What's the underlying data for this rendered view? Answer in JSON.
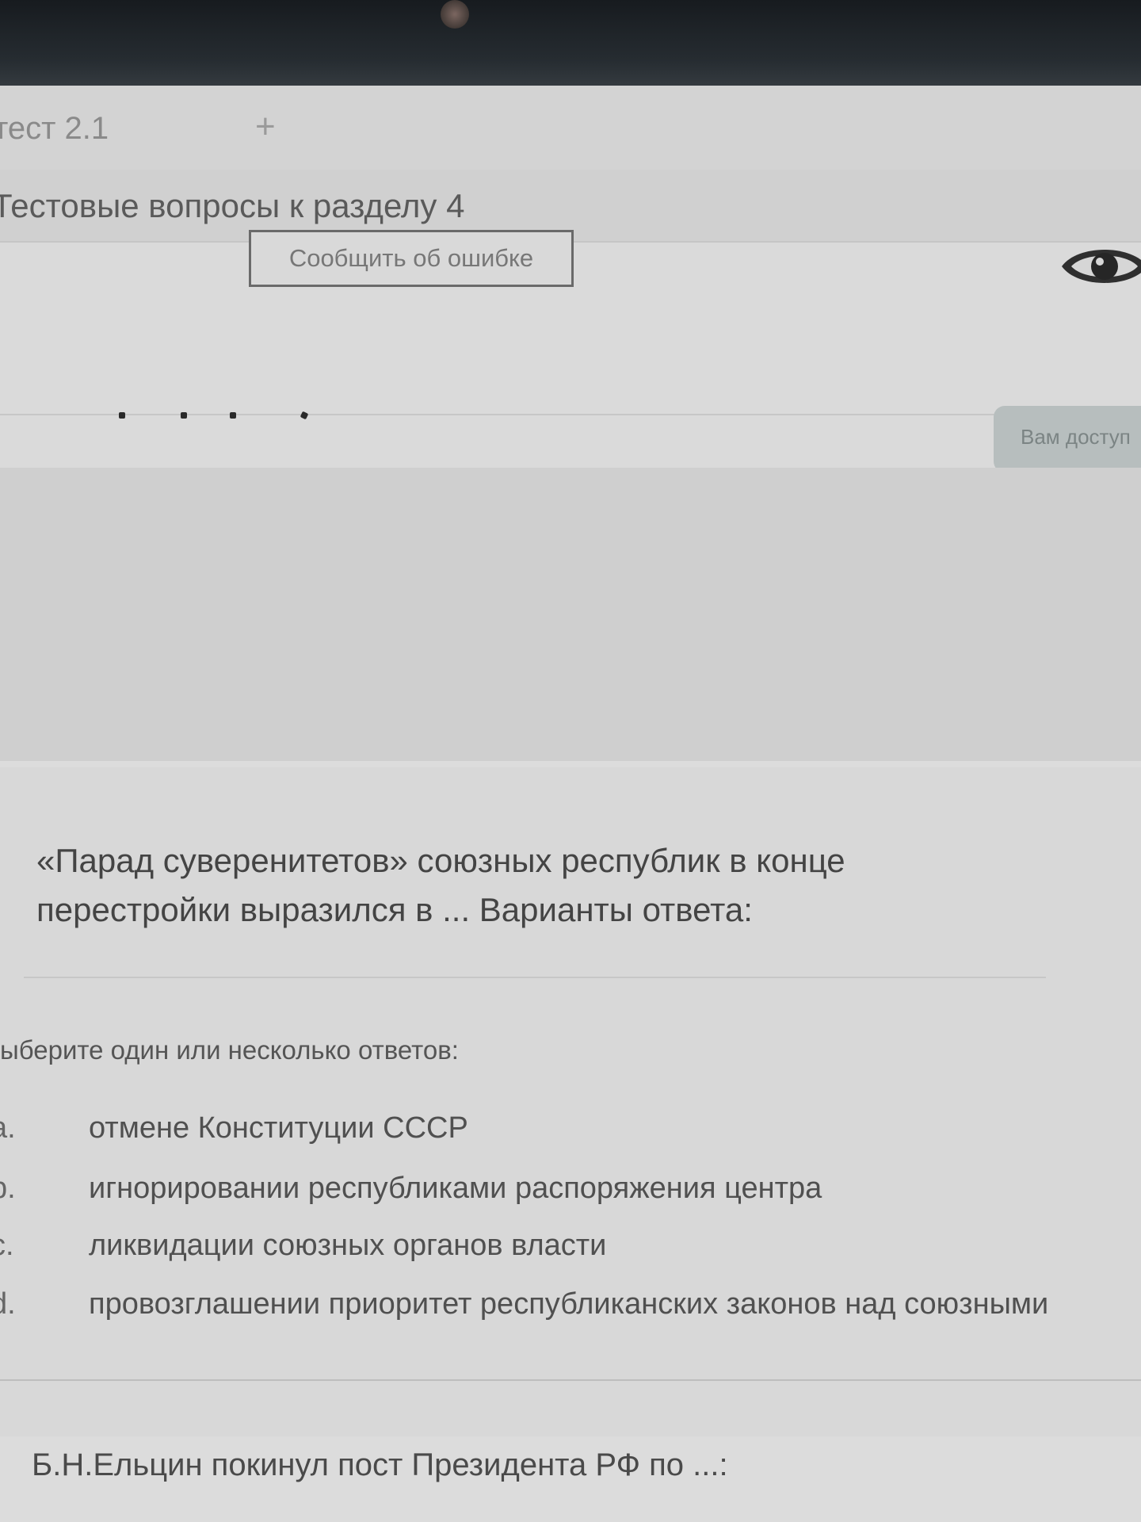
{
  "browser": {
    "tab_title": "тест 2.1",
    "new_tab_glyph": "+"
  },
  "header": {
    "title": "Тестовые вопросы к разделу 4"
  },
  "toolbar": {
    "report_button": "Сообщить об ошибке",
    "eye_icon": "eye-icon",
    "notice": "Вам доступ"
  },
  "question1": {
    "text": "«Парад суверенитетов» союзных республик в конце перестройки выразился в ... Варианты ответа:",
    "prompt": "Выберите один или несколько ответов:",
    "options": [
      {
        "letter": "a.",
        "text": "отмене Конституции СССР"
      },
      {
        "letter": "b.",
        "text": "игнорировании республиками распоряжения центра"
      },
      {
        "letter": "c.",
        "text": "ликвидации союзных органов власти"
      },
      {
        "letter": "d.",
        "text": "провозглашении приоритет республиканских законов над союзными"
      }
    ]
  },
  "question2": {
    "text": "Б.Н.Ельцин покинул пост Президента РФ по ...:"
  }
}
